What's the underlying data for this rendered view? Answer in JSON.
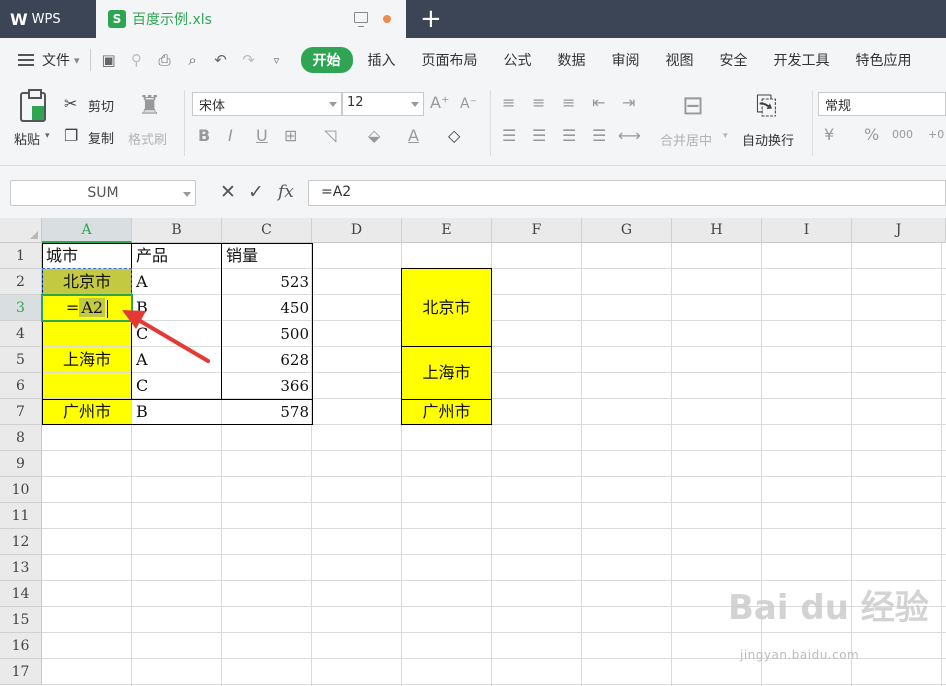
{
  "titlebar": {
    "app_name": "WPS",
    "doc_tab": {
      "icon": "S",
      "filename": "百度示例.xls"
    },
    "new_tab": "+"
  },
  "menubar": {
    "file": "文件",
    "tabs": [
      "开始",
      "插入",
      "页面布局",
      "公式",
      "数据",
      "审阅",
      "视图",
      "安全",
      "开发工具",
      "特色应用"
    ]
  },
  "ribbon": {
    "paste": "粘贴",
    "cut": "剪切",
    "copy": "复制",
    "format_painter": "格式刷",
    "font_name": "宋体",
    "font_size": "12",
    "merge_center": "合并居中",
    "wrap_text": "自动换行",
    "number_format": "常规"
  },
  "formula_bar": {
    "name_box": "SUM",
    "formula": "=A2",
    "fx": "fx"
  },
  "grid": {
    "columns": [
      "A",
      "B",
      "C",
      "D",
      "E",
      "F",
      "G",
      "H",
      "I",
      "J"
    ],
    "rows": [
      "1",
      "2",
      "3",
      "4",
      "5",
      "6",
      "7",
      "8",
      "9",
      "10",
      "11",
      "12",
      "13",
      "14",
      "15",
      "16",
      "17"
    ],
    "cells": {
      "A1": "城市",
      "B1": "产品",
      "C1": "销量",
      "A2": "北京市",
      "B2": "A",
      "C2": "523",
      "A3_prefix": "=",
      "A3_ref": "A2",
      "B3": "B",
      "C3": "450",
      "B4": "C",
      "C4": "500",
      "A5": "上海市",
      "B5": "A",
      "C5": "628",
      "B6": "C",
      "C6": "366",
      "A7": "广州市",
      "B7": "B",
      "C7": "578",
      "E2": "北京市",
      "E5": "上海市",
      "E7": "广州市"
    }
  },
  "colors": {
    "accent": "#2fa553",
    "highlight": "#ffff00",
    "reference": "#c3c941",
    "arrow": "#e53935"
  },
  "watermark": {
    "main": "Bai du 经验",
    "sub": "jingyan.baidu.com"
  }
}
